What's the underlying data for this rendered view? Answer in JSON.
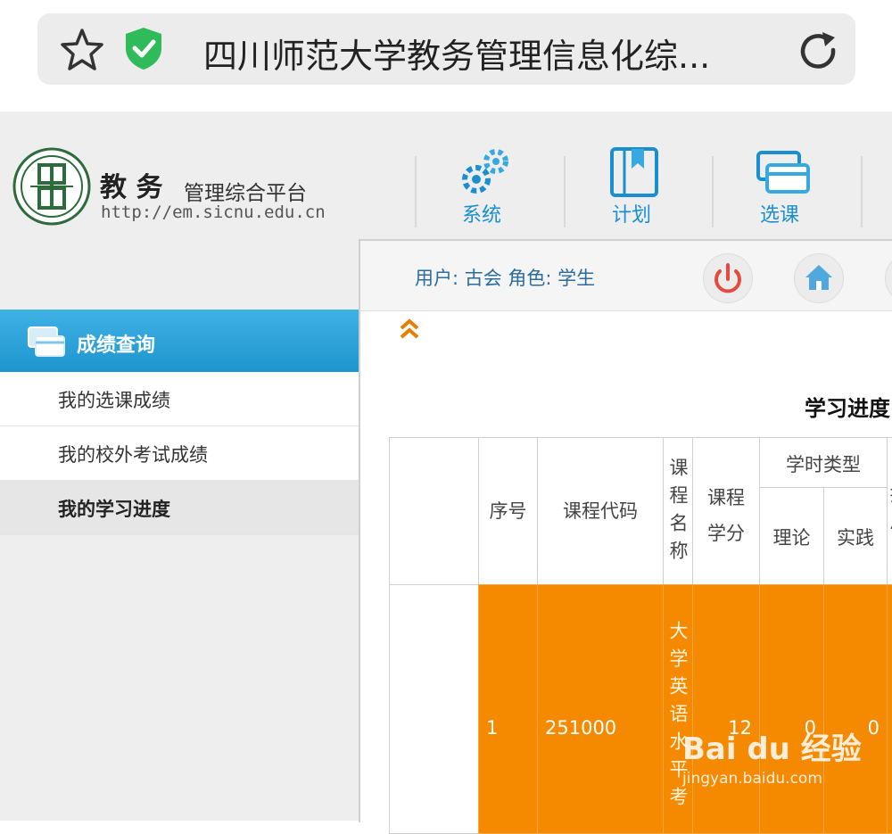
{
  "browser": {
    "url_text": "四川师范大学教务管理信息化综...",
    "star_icon": "star-outline-icon",
    "shield_icon": "shield-check-icon",
    "reload_icon": "reload-icon"
  },
  "header": {
    "brand_main": "教 务",
    "brand_sub": "管理综合平台",
    "url": "http://em.sicnu.edu.cn",
    "nav": [
      {
        "label": "系统",
        "icon": "gears-icon"
      },
      {
        "label": "计划",
        "icon": "book-icon"
      },
      {
        "label": "选课",
        "icon": "card-icon"
      }
    ]
  },
  "sidebar": {
    "section_title": "成绩查询",
    "items": [
      {
        "label": "我的选课成绩",
        "active": false
      },
      {
        "label": "我的校外考试成绩",
        "active": false
      },
      {
        "label": "我的学习进度",
        "active": true
      }
    ]
  },
  "userbar": {
    "user_text": "用户: 古会  角色: 学生",
    "power_icon": "power-icon",
    "home_icon": "home-icon"
  },
  "content": {
    "collapse_icon": "chevron-double-up-icon",
    "title": "学习进度",
    "table": {
      "headers": {
        "seq": "序号",
        "code": "课程代码",
        "name": "课程名称",
        "credits": "课程学分",
        "hours_type": "学时类型",
        "theory": "理论",
        "practice": "实践",
        "cut_col": "担总"
      },
      "row": {
        "seq": "1",
        "code": "251000",
        "name": "大学英语水平考",
        "credits": "12",
        "theory": "0",
        "practice": "0"
      }
    }
  },
  "colors": {
    "accent_blue": "#1f95cf",
    "row_orange": "#f58a00",
    "collapse_orange": "#e57f00"
  },
  "watermark": {
    "brand": "Bai du 经验",
    "url": "jingyan.baidu.com"
  }
}
